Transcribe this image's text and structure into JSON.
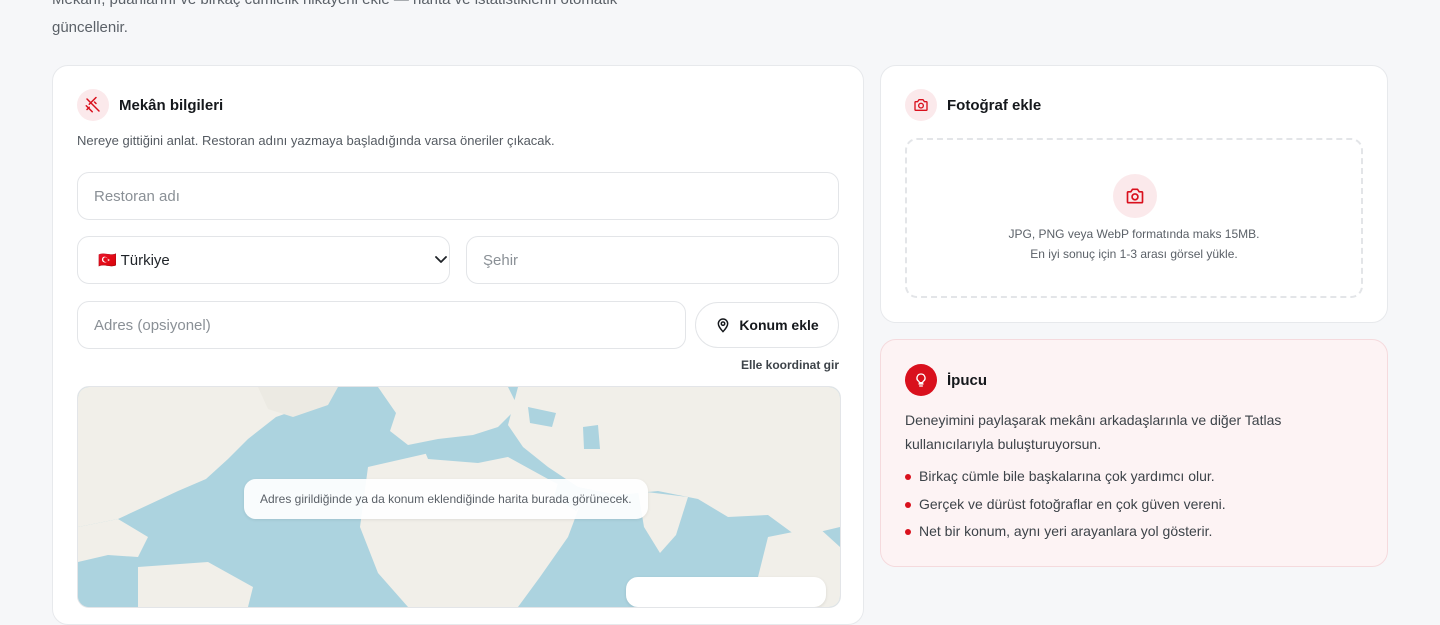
{
  "intro": {
    "line1": "Mekânı, puanlarını ve birkaç cümlelik hikayeni ekle — harita ve istatistiklerin otomatik",
    "line2": "güncellenir."
  },
  "venue": {
    "title": "Mekân bilgileri",
    "subtitle": "Nereye gittiğini anlat. Restoran adını yazmaya başladığında varsa öneriler çıkacak.",
    "restaurant_placeholder": "Restoran adı",
    "country_selected": "🇹🇷 Türkiye",
    "city_placeholder": "Şehir",
    "address_placeholder": "Adres (opsiyonel)",
    "location_button": "Konum ekle",
    "manual_coords_link": "Elle koordinat gir",
    "map_message": "Adres girildiğinde ya da konum eklendiğinde harita burada görünecek.",
    "icon": "utensils-crossed-icon"
  },
  "photo": {
    "title": "Fotoğraf ekle",
    "hint_line1": "JPG, PNG veya WebP formatında maks 15MB.",
    "hint_line2": "En iyi sonuç için 1-3 arası görsel yükle.",
    "icon": "camera-icon"
  },
  "tip": {
    "title": "İpucu",
    "text": "Deneyimini paylaşarak mekânı arkadaşlarınla ve diğer Tatlas kullanıcılarıyla buluşturuyorsun.",
    "items": [
      "Birkaç cümle bile başkalarına çok yardımcı olur.",
      "Gerçek ve dürüst fotoğraflar en çok güven vereni.",
      "Net bir konum, aynı yeri arayanlara yol gösterir."
    ],
    "icon": "lightbulb-icon"
  },
  "colors": {
    "accent": "#d9101d",
    "accent_soft": "#fbe9eb",
    "map_water": "#acd3df",
    "map_land": "#f1efe9"
  }
}
